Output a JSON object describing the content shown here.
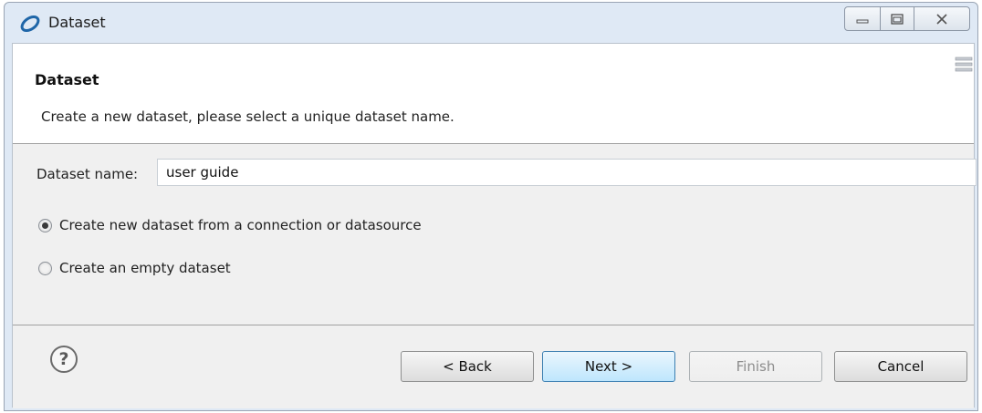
{
  "window": {
    "title": "Dataset",
    "controls": {
      "minimize": "minimize-icon",
      "maximize": "maximize-icon",
      "close": "close-icon"
    }
  },
  "header": {
    "title": "Dataset",
    "description": "Create a new dataset, please select a unique dataset name."
  },
  "form": {
    "name_label": "Dataset name:",
    "name_value": "user guide",
    "options": [
      {
        "label": "Create new dataset from a connection or datasource",
        "selected": true
      },
      {
        "label": "Create an empty dataset",
        "selected": false
      }
    ]
  },
  "footer": {
    "help_glyph": "?",
    "back_label": "< Back",
    "next_label": "Next >",
    "finish_label": "Finish",
    "cancel_label": "Cancel"
  },
  "colors": {
    "frame": "#dfe9f5",
    "next_button_border": "#3c7fb1",
    "disabled_text": "#8d8d8d"
  }
}
